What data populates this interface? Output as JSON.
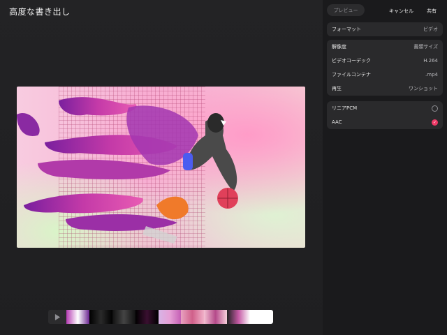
{
  "window": {
    "title": "高度な書き出し"
  },
  "toolbar": {
    "preview_label": "プレビュー",
    "cancel_label": "キャンセル",
    "share_label": "共有"
  },
  "settings": {
    "format": {
      "label": "フォーマット",
      "value": "ビデオ"
    },
    "resolution": {
      "label": "解像度",
      "value": "書類サイズ"
    },
    "codec": {
      "label": "ビデオコーデック",
      "value": "H.264"
    },
    "container": {
      "label": "ファイルコンテナ",
      "value": ".mp4"
    },
    "playback": {
      "label": "再生",
      "value": "ワンショット"
    }
  },
  "audio": {
    "options": [
      {
        "label": "リニアPCM",
        "selected": false
      },
      {
        "label": "AAC",
        "selected": true
      }
    ]
  },
  "colors": {
    "accent": "#ef3a67",
    "panel": "#2a2a2c",
    "background": "#1c1c1e"
  },
  "icons": {
    "play": "play-icon",
    "check": "check-icon"
  }
}
